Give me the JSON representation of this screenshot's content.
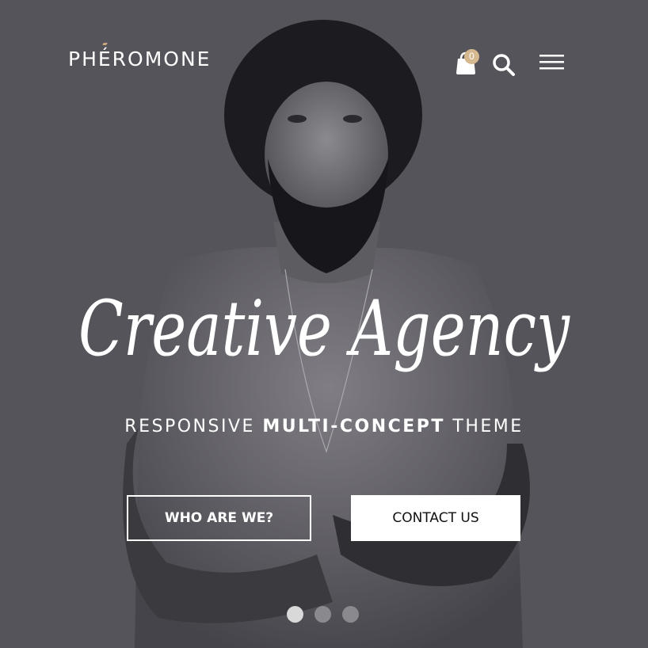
{
  "header": {
    "logo": {
      "before": "PH",
      "accent": "É",
      "after": "ROMONE"
    },
    "cart_count": "0"
  },
  "hero": {
    "headline": "Creative Agency",
    "subtitle": {
      "part1": "RESPONSIVE ",
      "bold": "MULTI-CONCEPT",
      "part2": " THEME"
    },
    "buttons": {
      "primary": "WHO ARE WE?",
      "secondary": "CONTACT US"
    }
  },
  "slider": {
    "total": 3,
    "active": 1
  },
  "colors": {
    "accent": "#d6b88f",
    "background": "#55545a",
    "text": "#ffffff"
  },
  "icons": [
    "shopping-bag-icon",
    "search-icon",
    "hamburger-menu-icon"
  ]
}
